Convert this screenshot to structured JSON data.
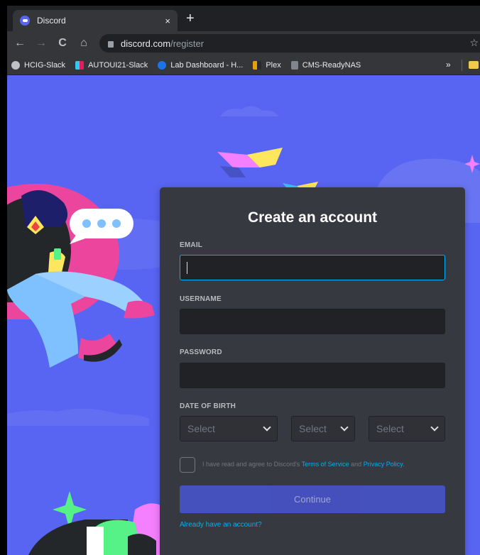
{
  "browser": {
    "tab_title": "Discord",
    "close_glyph": "×",
    "newtab_glyph": "+",
    "nav": {
      "back": "←",
      "forward": "→",
      "reload": "C",
      "home": "⌂"
    },
    "url_host": "discord.com",
    "url_path": "/register",
    "star_glyph": "☆",
    "bookmarks": [
      {
        "label": "HCIG-Slack",
        "color": "#bdc1c6"
      },
      {
        "label": "AUTOUI21-Slack",
        "color": "#36c5f0"
      },
      {
        "label": "Lab Dashboard - H...",
        "color": "#1a73e8"
      },
      {
        "label": "Plex",
        "color": "#e5a00d"
      },
      {
        "label": "CMS-ReadyNAS",
        "color": "#80868b"
      }
    ],
    "bookmarks_more": "»"
  },
  "form": {
    "title": "Create an account",
    "email_label": "EMAIL",
    "username_label": "USERNAME",
    "password_label": "PASSWORD",
    "dob_label": "DATE OF BIRTH",
    "dob_month": "Select",
    "dob_day": "Select",
    "dob_year": "Select",
    "terms_prefix": "I have read and agree to Discord's ",
    "terms_link": "Terms of Service",
    "terms_and": " and ",
    "privacy_link": "Privacy Policy",
    "terms_suffix": ".",
    "continue_label": "Continue",
    "login_link": "Already have an account?"
  },
  "colors": {
    "blurple": "#5865f2",
    "card": "#36393f",
    "input": "#202225",
    "focus": "#00b0f4",
    "link": "#00aff4",
    "button": "#4752c4"
  }
}
